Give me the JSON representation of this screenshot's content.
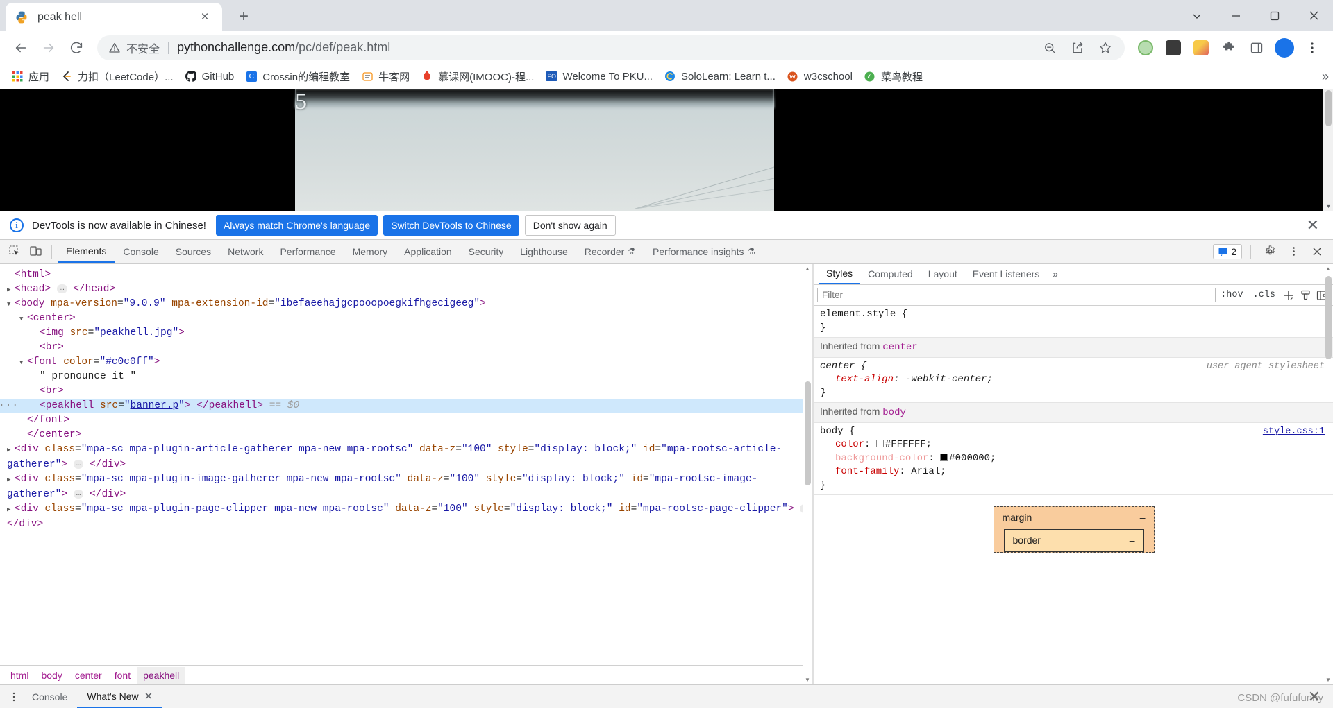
{
  "browser": {
    "tab": {
      "title": "peak hell",
      "favicon": "python-logo-icon",
      "close": "×"
    },
    "new_tab_label": "+",
    "window_controls": {
      "minimize": "–",
      "maximize": "▢",
      "close": "✕",
      "more": "⌄"
    },
    "nav": {
      "back": "←",
      "forward": "→",
      "reload": "⟳"
    },
    "omnibox": {
      "security_icon": "warning-triangle-icon",
      "security_text": "不安全",
      "url_host": "pythonchallenge.com",
      "url_path": "/pc/def/peak.html",
      "zoom_icon": "zoom-out-icon",
      "share_icon": "share-icon",
      "bookmark_icon": "star-icon",
      "profile_initial": "",
      "menu_icon": "three-dots-icon"
    },
    "bookmarks": {
      "items": [
        {
          "label": "应用",
          "icon": "apps-grid-icon"
        },
        {
          "label": "力扣（LeetCode）...",
          "icon": "leetcode-icon"
        },
        {
          "label": "GitHub",
          "icon": "github-icon"
        },
        {
          "label": "Crossin的编程教室",
          "icon": "crossin-icon"
        },
        {
          "label": "牛客网",
          "icon": "nowcoder-icon"
        },
        {
          "label": "慕课网(IMOOC)-程...",
          "icon": "imooc-icon"
        },
        {
          "label": "Welcome To PKU...",
          "icon": "pku-icon"
        },
        {
          "label": "SoloLearn: Learn t...",
          "icon": "sololearn-icon"
        },
        {
          "label": "w3cschool",
          "icon": "w3cschool-icon"
        },
        {
          "label": "菜鸟教程",
          "icon": "runoob-icon"
        }
      ],
      "overflow": "»"
    }
  },
  "page": {
    "image_label": "5",
    "image_alt": "peakhell.jpg"
  },
  "devtools": {
    "banner": {
      "icon": "info-circle-icon",
      "message": "DevTools is now available in Chinese!",
      "primary_button": "Always match Chrome's language",
      "secondary_button": "Switch DevTools to Chinese",
      "dismiss_button": "Don't show again",
      "close": "✕",
      "accent_color": "#1a73e8"
    },
    "toolbar": {
      "inspect_icon": "inspect-element-icon",
      "device_icon": "device-toolbar-icon",
      "tabs": [
        {
          "label": "Elements",
          "active": true
        },
        {
          "label": "Console",
          "active": false
        },
        {
          "label": "Sources",
          "active": false
        },
        {
          "label": "Network",
          "active": false
        },
        {
          "label": "Performance",
          "active": false
        },
        {
          "label": "Memory",
          "active": false
        },
        {
          "label": "Application",
          "active": false
        },
        {
          "label": "Security",
          "active": false
        },
        {
          "label": "Lighthouse",
          "active": false
        },
        {
          "label": "Recorder",
          "active": false,
          "badge": "experiment-flask-icon"
        },
        {
          "label": "Performance insights",
          "active": false,
          "badge": "experiment-flask-icon"
        }
      ],
      "issues_count": "2",
      "issues_icon": "issues-icon",
      "settings_icon": "gear-icon",
      "more_icon": "three-dots-vertical-icon",
      "close_icon": "close-icon"
    },
    "dom": {
      "lines": [
        {
          "indent": 0,
          "twisty": "",
          "html": "<span class=\"tag\">&lt;html&gt;</span>"
        },
        {
          "indent": 0,
          "twisty": "▶",
          "html": "<span class=\"tag\">&lt;head&gt;</span> <span class=\"ellipsis-badge\">…</span> <span class=\"tag\">&lt;/head&gt;</span>"
        },
        {
          "indent": 0,
          "twisty": "▼",
          "html": "<span class=\"tag\">&lt;body</span> <span class=\"attr\">mpa-version</span>=<span class=\"val\">\"9.0.9\"</span> <span class=\"attr\">mpa-extension-id</span>=<span class=\"val\">\"ibefaeehajgcpooopoegkifhgecigeeg\"</span><span class=\"tag\">&gt;</span>"
        },
        {
          "indent": 1,
          "twisty": "▼",
          "html": "<span class=\"tag\">&lt;center&gt;</span>"
        },
        {
          "indent": 2,
          "twisty": "",
          "html": "<span class=\"tag\">&lt;img</span> <span class=\"attr\">src</span>=<span class=\"val\">\"</span><span class=\"valu\">peakhell.jpg</span><span class=\"val\">\"</span><span class=\"tag\">&gt;</span>"
        },
        {
          "indent": 2,
          "twisty": "",
          "html": "<span class=\"tag\">&lt;br&gt;</span>"
        },
        {
          "indent": 1,
          "twisty": "▼",
          "html": "<span class=\"tag\">&lt;font</span> <span class=\"attr\">color</span>=<span class=\"val\">\"#c0c0ff\"</span><span class=\"tag\">&gt;</span>"
        },
        {
          "indent": 2,
          "twisty": "",
          "html": "<span class=\"txt\">\" pronounce it \"</span>"
        },
        {
          "indent": 2,
          "twisty": "",
          "html": "<span class=\"tag\">&lt;br&gt;</span>"
        },
        {
          "indent": 2,
          "twisty": "",
          "selected": true,
          "dots": "···",
          "html": "<span class=\"tag\">&lt;peakhell</span> <span class=\"attr\">src</span>=<span class=\"val\">\"</span><span class=\"valu\">banner.p</span><span class=\"val\">\"</span><span class=\"tag\">&gt;</span> <span class=\"tag\">&lt;/peakhell&gt;</span> <span class=\"dim\">== $0</span>"
        },
        {
          "indent": 1,
          "twisty": "",
          "html": "<span class=\"tag\">&lt;/font&gt;</span>"
        },
        {
          "indent": 1,
          "twisty": "",
          "html": "<span class=\"tag\">&lt;/center&gt;</span>"
        },
        {
          "indent": 0,
          "twisty": "▶",
          "wrap": true,
          "html": "<span class=\"tag\">&lt;div</span> <span class=\"attr\">class</span>=<span class=\"val\">\"mpa-sc mpa-plugin-article-gatherer mpa-new mpa-rootsc\"</span> <span class=\"attr\">data-z</span>=<span class=\"val\">\"100\"</span> <span class=\"attr\">style</span>=<span class=\"val\">\"display: block;\"</span> <span class=\"attr\">id</span>=<span class=\"val\">\"mpa-rootsc-article-gatherer\"</span><span class=\"tag\">&gt;</span> <span class=\"ellipsis-badge\">…</span> <span class=\"tag\">&lt;/div&gt;</span>"
        },
        {
          "indent": 0,
          "twisty": "▶",
          "wrap": true,
          "html": "<span class=\"tag\">&lt;div</span> <span class=\"attr\">class</span>=<span class=\"val\">\"mpa-sc mpa-plugin-image-gatherer mpa-new mpa-rootsc\"</span> <span class=\"attr\">data-z</span>=<span class=\"val\">\"100\"</span> <span class=\"attr\">style</span>=<span class=\"val\">\"display: block;\"</span> <span class=\"attr\">id</span>=<span class=\"val\">\"mpa-rootsc-image-gatherer\"</span><span class=\"tag\">&gt;</span> <span class=\"ellipsis-badge\">…</span> <span class=\"tag\">&lt;/div&gt;</span>"
        },
        {
          "indent": 0,
          "twisty": "▶",
          "wrap": true,
          "html": "<span class=\"tag\">&lt;div</span> <span class=\"attr\">class</span>=<span class=\"val\">\"mpa-sc mpa-plugin-page-clipper mpa-new mpa-rootsc\"</span> <span class=\"attr\">data-z</span>=<span class=\"val\">\"100\"</span> <span class=\"attr\">style</span>=<span class=\"val\">\"display: block;\"</span> <span class=\"attr\">id</span>=<span class=\"val\">\"mpa-rootsc-page-clipper\"</span><span class=\"tag\">&gt;</span> <span class=\"ellipsis-badge\">…</span> <span class=\"tag\">&lt;/div&gt;</span>"
        }
      ]
    },
    "breadcrumbs": [
      {
        "label": "html",
        "active": false
      },
      {
        "label": "body",
        "active": false
      },
      {
        "label": "center",
        "active": false
      },
      {
        "label": "font",
        "active": false
      },
      {
        "label": "peakhell",
        "active": true
      }
    ],
    "sidebar": {
      "tabs": [
        {
          "label": "Styles",
          "active": true
        },
        {
          "label": "Computed",
          "active": false
        },
        {
          "label": "Layout",
          "active": false
        },
        {
          "label": "Event Listeners",
          "active": false
        }
      ],
      "more": "»",
      "filter_placeholder": "Filter",
      "filter_value": "",
      "hov_label": ":hov",
      "cls_label": ".cls",
      "new_rule_icon": "plus-icon",
      "class_icon": "paintbrush-icon",
      "sidebar_toggle_icon": "panel-toggle-icon",
      "rules": [
        {
          "type": "rule",
          "selector": "element.style {",
          "close": "}",
          "origin": "",
          "props": []
        },
        {
          "type": "inherited",
          "text": "Inherited from ",
          "source": "center"
        },
        {
          "type": "rule",
          "selector": "center {",
          "close": "}",
          "origin": "user agent stylesheet",
          "italic_selector": true,
          "props": [
            {
              "name": "text-align",
              "value": "-webkit-center;",
              "dimmed": false,
              "italic": true
            }
          ]
        },
        {
          "type": "inherited",
          "text": "Inherited from ",
          "source": "body"
        },
        {
          "type": "rule",
          "selector": "body {",
          "close": "}",
          "origin": "style.css:1",
          "origin_link": true,
          "props": [
            {
              "name": "color",
              "value": "#FFFFFF;",
              "swatch": "#FFFFFF",
              "dimmed": false
            },
            {
              "name": "background-color",
              "value": "#000000;",
              "swatch": "#000000",
              "dimmed": true
            },
            {
              "name": "font-family",
              "value": "Arial;",
              "dimmed": false
            }
          ]
        }
      ],
      "box_model": {
        "margin_label": "margin",
        "margin_value": "–",
        "border_label": "border",
        "border_value": "–",
        "margin_color": "#f9cc9d",
        "border_color": "#fddfad"
      }
    },
    "drawer": {
      "menu_icon": "three-dots-vertical-icon",
      "tabs": [
        {
          "label": "Console",
          "active": false
        },
        {
          "label": "What's New",
          "active": true,
          "closable": true
        }
      ],
      "close": "✕"
    }
  },
  "watermark": {
    "text": "CSDN @fufufunny",
    "close": "✕"
  }
}
